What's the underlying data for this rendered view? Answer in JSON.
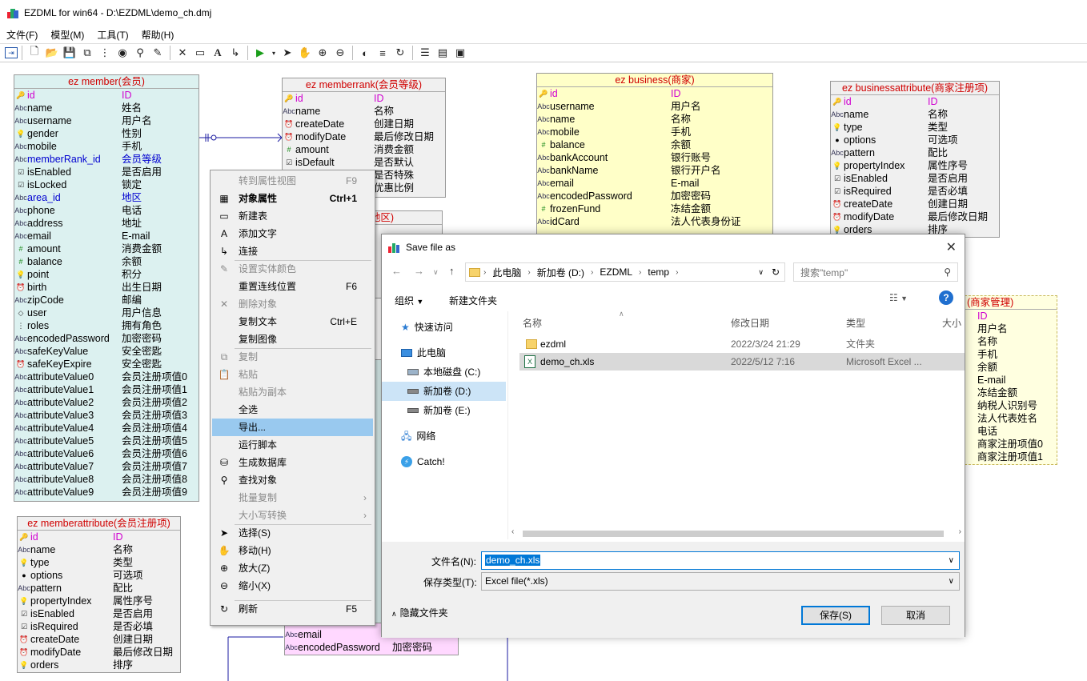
{
  "window": {
    "title": "EZDML for win64 - D:\\EZDML\\demo_ch.dmj"
  },
  "menu": [
    "文件(F)",
    "模型(M)",
    "工具(T)",
    "帮助(H)"
  ],
  "entities": {
    "member": {
      "title": "ez member(会员)",
      "fields": [
        [
          "id",
          "ID",
          "pk"
        ],
        [
          "name",
          "姓名",
          ""
        ],
        [
          "username",
          "用户名",
          ""
        ],
        [
          "gender",
          "性别",
          ""
        ],
        [
          "mobile",
          "手机",
          ""
        ],
        [
          "memberRank_id",
          "会员等级",
          "fk"
        ],
        [
          "isEnabled",
          "是否启用",
          ""
        ],
        [
          "isLocked",
          "锁定",
          ""
        ],
        [
          "area_id",
          "地区",
          "fk"
        ],
        [
          "phone",
          "电话",
          ""
        ],
        [
          "address",
          "地址",
          ""
        ],
        [
          "email",
          "E-mail",
          ""
        ],
        [
          "amount",
          "消费金额",
          ""
        ],
        [
          "balance",
          "余额",
          ""
        ],
        [
          "point",
          "积分",
          ""
        ],
        [
          "birth",
          "出生日期",
          ""
        ],
        [
          "zipCode",
          "邮编",
          ""
        ],
        [
          "user",
          "用户信息",
          ""
        ],
        [
          "roles",
          "拥有角色",
          ""
        ],
        [
          "encodedPassword",
          "加密密码",
          ""
        ],
        [
          "safeKeyValue",
          "安全密匙",
          ""
        ],
        [
          "safeKeyExpire",
          "安全密匙",
          ""
        ],
        [
          "attributeValue0",
          "会员注册项值0",
          ""
        ],
        [
          "attributeValue1",
          "会员注册项值1",
          ""
        ],
        [
          "attributeValue2",
          "会员注册项值2",
          ""
        ],
        [
          "attributeValue3",
          "会员注册项值3",
          ""
        ],
        [
          "attributeValue4",
          "会员注册项值4",
          ""
        ],
        [
          "attributeValue5",
          "会员注册项值5",
          ""
        ],
        [
          "attributeValue6",
          "会员注册项值6",
          ""
        ],
        [
          "attributeValue7",
          "会员注册项值7",
          ""
        ],
        [
          "attributeValue8",
          "会员注册项值8",
          ""
        ],
        [
          "attributeValue9",
          "会员注册项值9",
          ""
        ]
      ]
    },
    "memberrank": {
      "title": "ez memberrank(会员等级)",
      "fields": [
        [
          "id",
          "ID",
          "pk"
        ],
        [
          "name",
          "名称",
          ""
        ],
        [
          "createDate",
          "创建日期",
          ""
        ],
        [
          "modifyDate",
          "最后修改日期",
          ""
        ],
        [
          "amount",
          "消费金额",
          ""
        ],
        [
          "isDefault",
          "是否默认",
          ""
        ],
        [
          "",
          "是否特殊",
          ""
        ],
        [
          "",
          "优惠比例",
          ""
        ]
      ]
    },
    "business": {
      "title": "ez business(商家)",
      "fields": [
        [
          "id",
          "ID",
          "pk"
        ],
        [
          "username",
          "用户名",
          ""
        ],
        [
          "name",
          "名称",
          ""
        ],
        [
          "mobile",
          "手机",
          ""
        ],
        [
          "balance",
          "余额",
          ""
        ],
        [
          "bankAccount",
          "银行账号",
          ""
        ],
        [
          "bankName",
          "银行开户名",
          ""
        ],
        [
          "email",
          "E-mail",
          ""
        ],
        [
          "encodedPassword",
          "加密密码",
          ""
        ],
        [
          "frozenFund",
          "冻结金额",
          ""
        ],
        [
          "idCard",
          "法人代表身份证",
          ""
        ]
      ]
    },
    "businessattribute": {
      "title": "ez businessattribute(商家注册项)",
      "fields": [
        [
          "id",
          "ID",
          "pk"
        ],
        [
          "name",
          "名称",
          ""
        ],
        [
          "type",
          "类型",
          ""
        ],
        [
          "options",
          "可选项",
          ""
        ],
        [
          "pattern",
          "配比",
          ""
        ],
        [
          "propertyIndex",
          "属性序号",
          ""
        ],
        [
          "isEnabled",
          "是否启用",
          ""
        ],
        [
          "isRequired",
          "是否必填",
          ""
        ],
        [
          "createDate",
          "创建日期",
          ""
        ],
        [
          "modifyDate",
          "最后修改日期",
          ""
        ],
        [
          "orders",
          "排序",
          ""
        ]
      ]
    },
    "businessmanage": {
      "title": "(商家管理)",
      "fields": [
        [
          "",
          "ID",
          "pk"
        ],
        [
          "",
          "用户名",
          ""
        ],
        [
          "",
          "名称",
          ""
        ],
        [
          "",
          "手机",
          ""
        ],
        [
          "",
          "余额",
          ""
        ],
        [
          "",
          "E-mail",
          ""
        ],
        [
          "",
          "冻结金额",
          ""
        ],
        [
          "",
          "纳税人识别号",
          ""
        ],
        [
          "",
          "法人代表姓名",
          ""
        ],
        [
          "",
          "电话",
          ""
        ],
        [
          "",
          "商家注册项值0",
          ""
        ],
        [
          "",
          "商家注册项值1",
          ""
        ]
      ]
    },
    "memberattribute": {
      "title": "ez memberattribute(会员注册项)",
      "fields": [
        [
          "id",
          "ID",
          "pk"
        ],
        [
          "name",
          "名称",
          ""
        ],
        [
          "type",
          "类型",
          ""
        ],
        [
          "options",
          "可选项",
          ""
        ],
        [
          "pattern",
          "配比",
          ""
        ],
        [
          "propertyIndex",
          "属性序号",
          ""
        ],
        [
          "isEnabled",
          "是否启用",
          ""
        ],
        [
          "isRequired",
          "是否必填",
          ""
        ],
        [
          "createDate",
          "创建日期",
          ""
        ],
        [
          "modifyDate",
          "最后修改日期",
          ""
        ],
        [
          "orders",
          "排序",
          ""
        ]
      ]
    },
    "admin": {
      "title": "",
      "fields": [
        [
          "email",
          "E-mail",
          ""
        ],
        [
          "encodedPassword",
          "加密密码",
          ""
        ]
      ]
    },
    "area": {
      "title": "地区)"
    }
  },
  "context_menu": {
    "items": [
      {
        "label": "转到属性视图",
        "shortcut": "F9",
        "disabled": true
      },
      {
        "label": "对象属性",
        "shortcut": "Ctrl+1",
        "bold": true
      },
      {
        "label": "新建表"
      },
      {
        "label": "添加文字"
      },
      {
        "label": "连接"
      },
      {
        "label": "设置实体颜色",
        "disabled": true
      },
      {
        "label": "重置连线位置",
        "shortcut": "F6"
      },
      {
        "label": "删除对象",
        "disabled": true
      },
      {
        "label": "复制文本",
        "shortcut": "Ctrl+E"
      },
      {
        "label": "复制图像"
      },
      {
        "label": "复制",
        "disabled": true
      },
      {
        "label": "粘贴",
        "disabled": true
      },
      {
        "label": "粘贴为副本",
        "disabled": true
      },
      {
        "label": "全选"
      },
      {
        "label": "导出...",
        "highlight": true
      },
      {
        "label": "运行脚本"
      },
      {
        "label": "生成数据库"
      },
      {
        "label": "查找对象"
      },
      {
        "label": "批量复制",
        "disabled": true,
        "submenu": true
      },
      {
        "label": "大小写转换",
        "disabled": true,
        "submenu": true
      },
      {
        "label": "选择(S)"
      },
      {
        "label": "移动(H)"
      },
      {
        "label": "放大(Z)"
      },
      {
        "label": "缩小(X)"
      },
      {
        "label": "刷新",
        "shortcut": "F5"
      }
    ]
  },
  "dialog": {
    "title": "Save file as",
    "breadcrumb": [
      "此电脑",
      "新加卷 (D:)",
      "EZDML",
      "temp"
    ],
    "search_placeholder": "搜索\"temp\"",
    "organize": "组织",
    "new_folder": "新建文件夹",
    "nav": [
      {
        "label": "快速访问"
      },
      {
        "label": "此电脑"
      },
      {
        "label": "本地磁盘 (C:)"
      },
      {
        "label": "新加卷 (D:)",
        "selected": true
      },
      {
        "label": "新加卷 (E:)"
      },
      {
        "label": "网络"
      },
      {
        "label": "Catch!"
      }
    ],
    "columns": [
      "名称",
      "修改日期",
      "类型",
      "大小"
    ],
    "files": [
      {
        "name": "ezdml",
        "date": "2022/3/24 21:29",
        "type": "文件夹"
      },
      {
        "name": "demo_ch.xls",
        "date": "2022/5/12 7:16",
        "type": "Microsoft Excel ...",
        "selected": true
      }
    ],
    "filename_label": "文件名(N):",
    "filename_value": "demo_ch.xls",
    "filetype_label": "保存类型(T):",
    "filetype_value": "Excel file(*.xls)",
    "hide_folders": "隐藏文件夹",
    "save": "保存(S)",
    "cancel": "取消"
  }
}
